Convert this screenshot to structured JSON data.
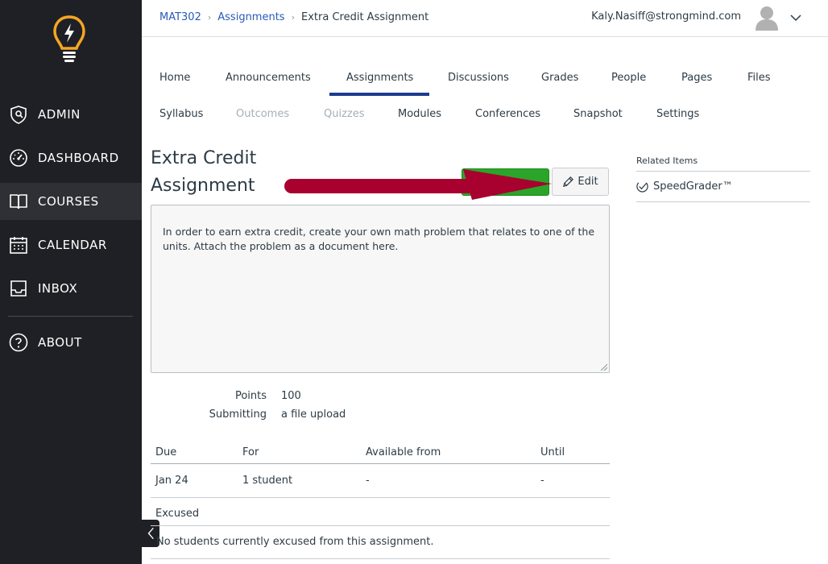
{
  "sidebar": {
    "logo": "lightbulb-logo",
    "items": [
      {
        "label": "ADMIN",
        "icon": "shield-icon"
      },
      {
        "label": "DASHBOARD",
        "icon": "gauge-icon"
      },
      {
        "label": "COURSES",
        "icon": "book-icon"
      },
      {
        "label": "CALENDAR",
        "icon": "calendar-icon"
      },
      {
        "label": "INBOX",
        "icon": "inbox-icon"
      },
      {
        "label": "ABOUT",
        "icon": "question-icon"
      }
    ],
    "active": "COURSES"
  },
  "header": {
    "breadcrumbs": [
      "MAT302",
      "Assignments",
      "Extra Credit Assignment"
    ],
    "user_email": "Kaly.Nasiff@strongmind.com"
  },
  "course_nav": {
    "row1": [
      "Home",
      "Announcements",
      "Assignments",
      "Discussions",
      "Grades",
      "People",
      "Pages",
      "Files"
    ],
    "row2": [
      "Syllabus",
      "Outcomes",
      "Quizzes",
      "Modules",
      "Conferences",
      "Snapshot",
      "Settings"
    ],
    "active": "Assignments",
    "disabled": [
      "Outcomes",
      "Quizzes"
    ]
  },
  "assignment": {
    "title": "Extra Credit Assignment",
    "edit_label": "Edit",
    "description": "In order to earn extra credit, create your own math problem that relates to one of the units. Attach the problem as a document here.",
    "points_label": "Points",
    "points_value": "100",
    "submitting_label": "Submitting",
    "submitting_value": "a file upload"
  },
  "dates_table": {
    "headers": [
      "Due",
      "For",
      "Available from",
      "Until"
    ],
    "rows": [
      [
        "Jan 24",
        "1 student",
        "-",
        "-"
      ]
    ]
  },
  "excused": {
    "label": "Excused",
    "text": "No students currently excused from this assignment."
  },
  "related": {
    "title": "Related Items",
    "items": [
      "SpeedGrader™"
    ]
  },
  "colors": {
    "sidebar_bg": "#1f2025",
    "accent": "#1d3b8f",
    "logo": "#f5a623",
    "publish_green": "#2aa52a",
    "annotation_arrow": "#a8002f"
  }
}
